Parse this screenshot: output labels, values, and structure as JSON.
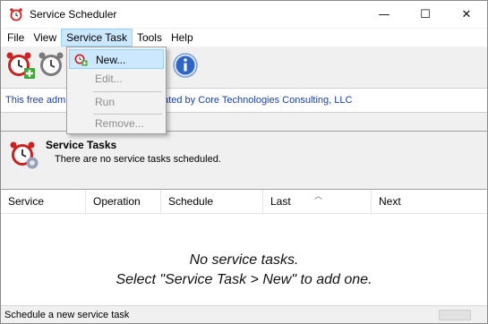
{
  "window": {
    "title": "Service Scheduler",
    "minimize": "—",
    "maximize": "☐",
    "close": "✕"
  },
  "menubar": [
    "File",
    "View",
    "Service Task",
    "Tools",
    "Help"
  ],
  "dropdown": {
    "items": [
      {
        "label": "New...",
        "state": "selected"
      },
      {
        "label": "Edit...",
        "state": "disabled"
      },
      {
        "label": "Run",
        "state": "disabled"
      },
      {
        "label": "Remove...",
        "state": "disabled"
      }
    ]
  },
  "banner": {
    "text": "This free administration tool was created by Core Technologies Consulting, LLC"
  },
  "tasks": {
    "title": "Service Tasks",
    "subtitle": "There are no service tasks scheduled."
  },
  "columns": [
    "Service",
    "Operation",
    "Schedule",
    "Last",
    "Next"
  ],
  "empty": {
    "line1": "No service tasks.",
    "line2": "Select \"Service Task > New\" to add one."
  },
  "status": "Schedule a new service task",
  "colors": {
    "accent": "#cce8ff",
    "accent_border": "#99d1ff",
    "banner_text": "#1a3fb0",
    "disabled_text": "#8d8d8d"
  },
  "icons": [
    "app-clock-icon",
    "new-task-icon",
    "edit-task-icon",
    "info-icon",
    "service-tasks-icon"
  ]
}
